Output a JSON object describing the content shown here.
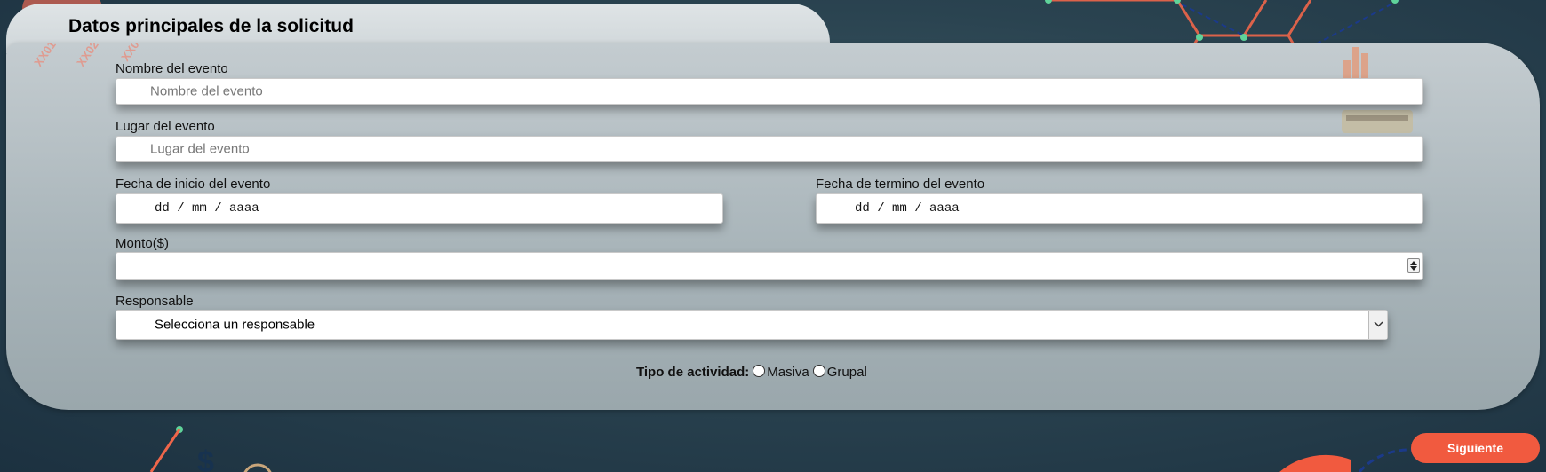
{
  "header": {
    "title": "Datos principales de la solicitud"
  },
  "form": {
    "event_name": {
      "label": "Nombre del evento",
      "placeholder": "Nombre del evento",
      "value": ""
    },
    "event_place": {
      "label": "Lugar del evento",
      "placeholder": "Lugar del evento",
      "value": ""
    },
    "start_date": {
      "label": "Fecha de inicio del evento",
      "display": "dd / mm / aaaa"
    },
    "end_date": {
      "label": "Fecha de termino del evento",
      "display": "dd / mm / aaaa"
    },
    "amount": {
      "label": "Monto($)",
      "value": ""
    },
    "responsible": {
      "label": "Responsable",
      "selected": "Selecciona un responsable"
    },
    "activity_type": {
      "legend": "Tipo de actividad:",
      "options": [
        "Masiva",
        "Grupal"
      ]
    }
  },
  "background": {
    "tags": [
      "XX01",
      "XX02",
      "XX03"
    ]
  },
  "actions": {
    "next_label": "Siguiente"
  },
  "colors": {
    "accent": "#f15a3f",
    "panel": "#b3bec2",
    "background": "#24404d"
  }
}
